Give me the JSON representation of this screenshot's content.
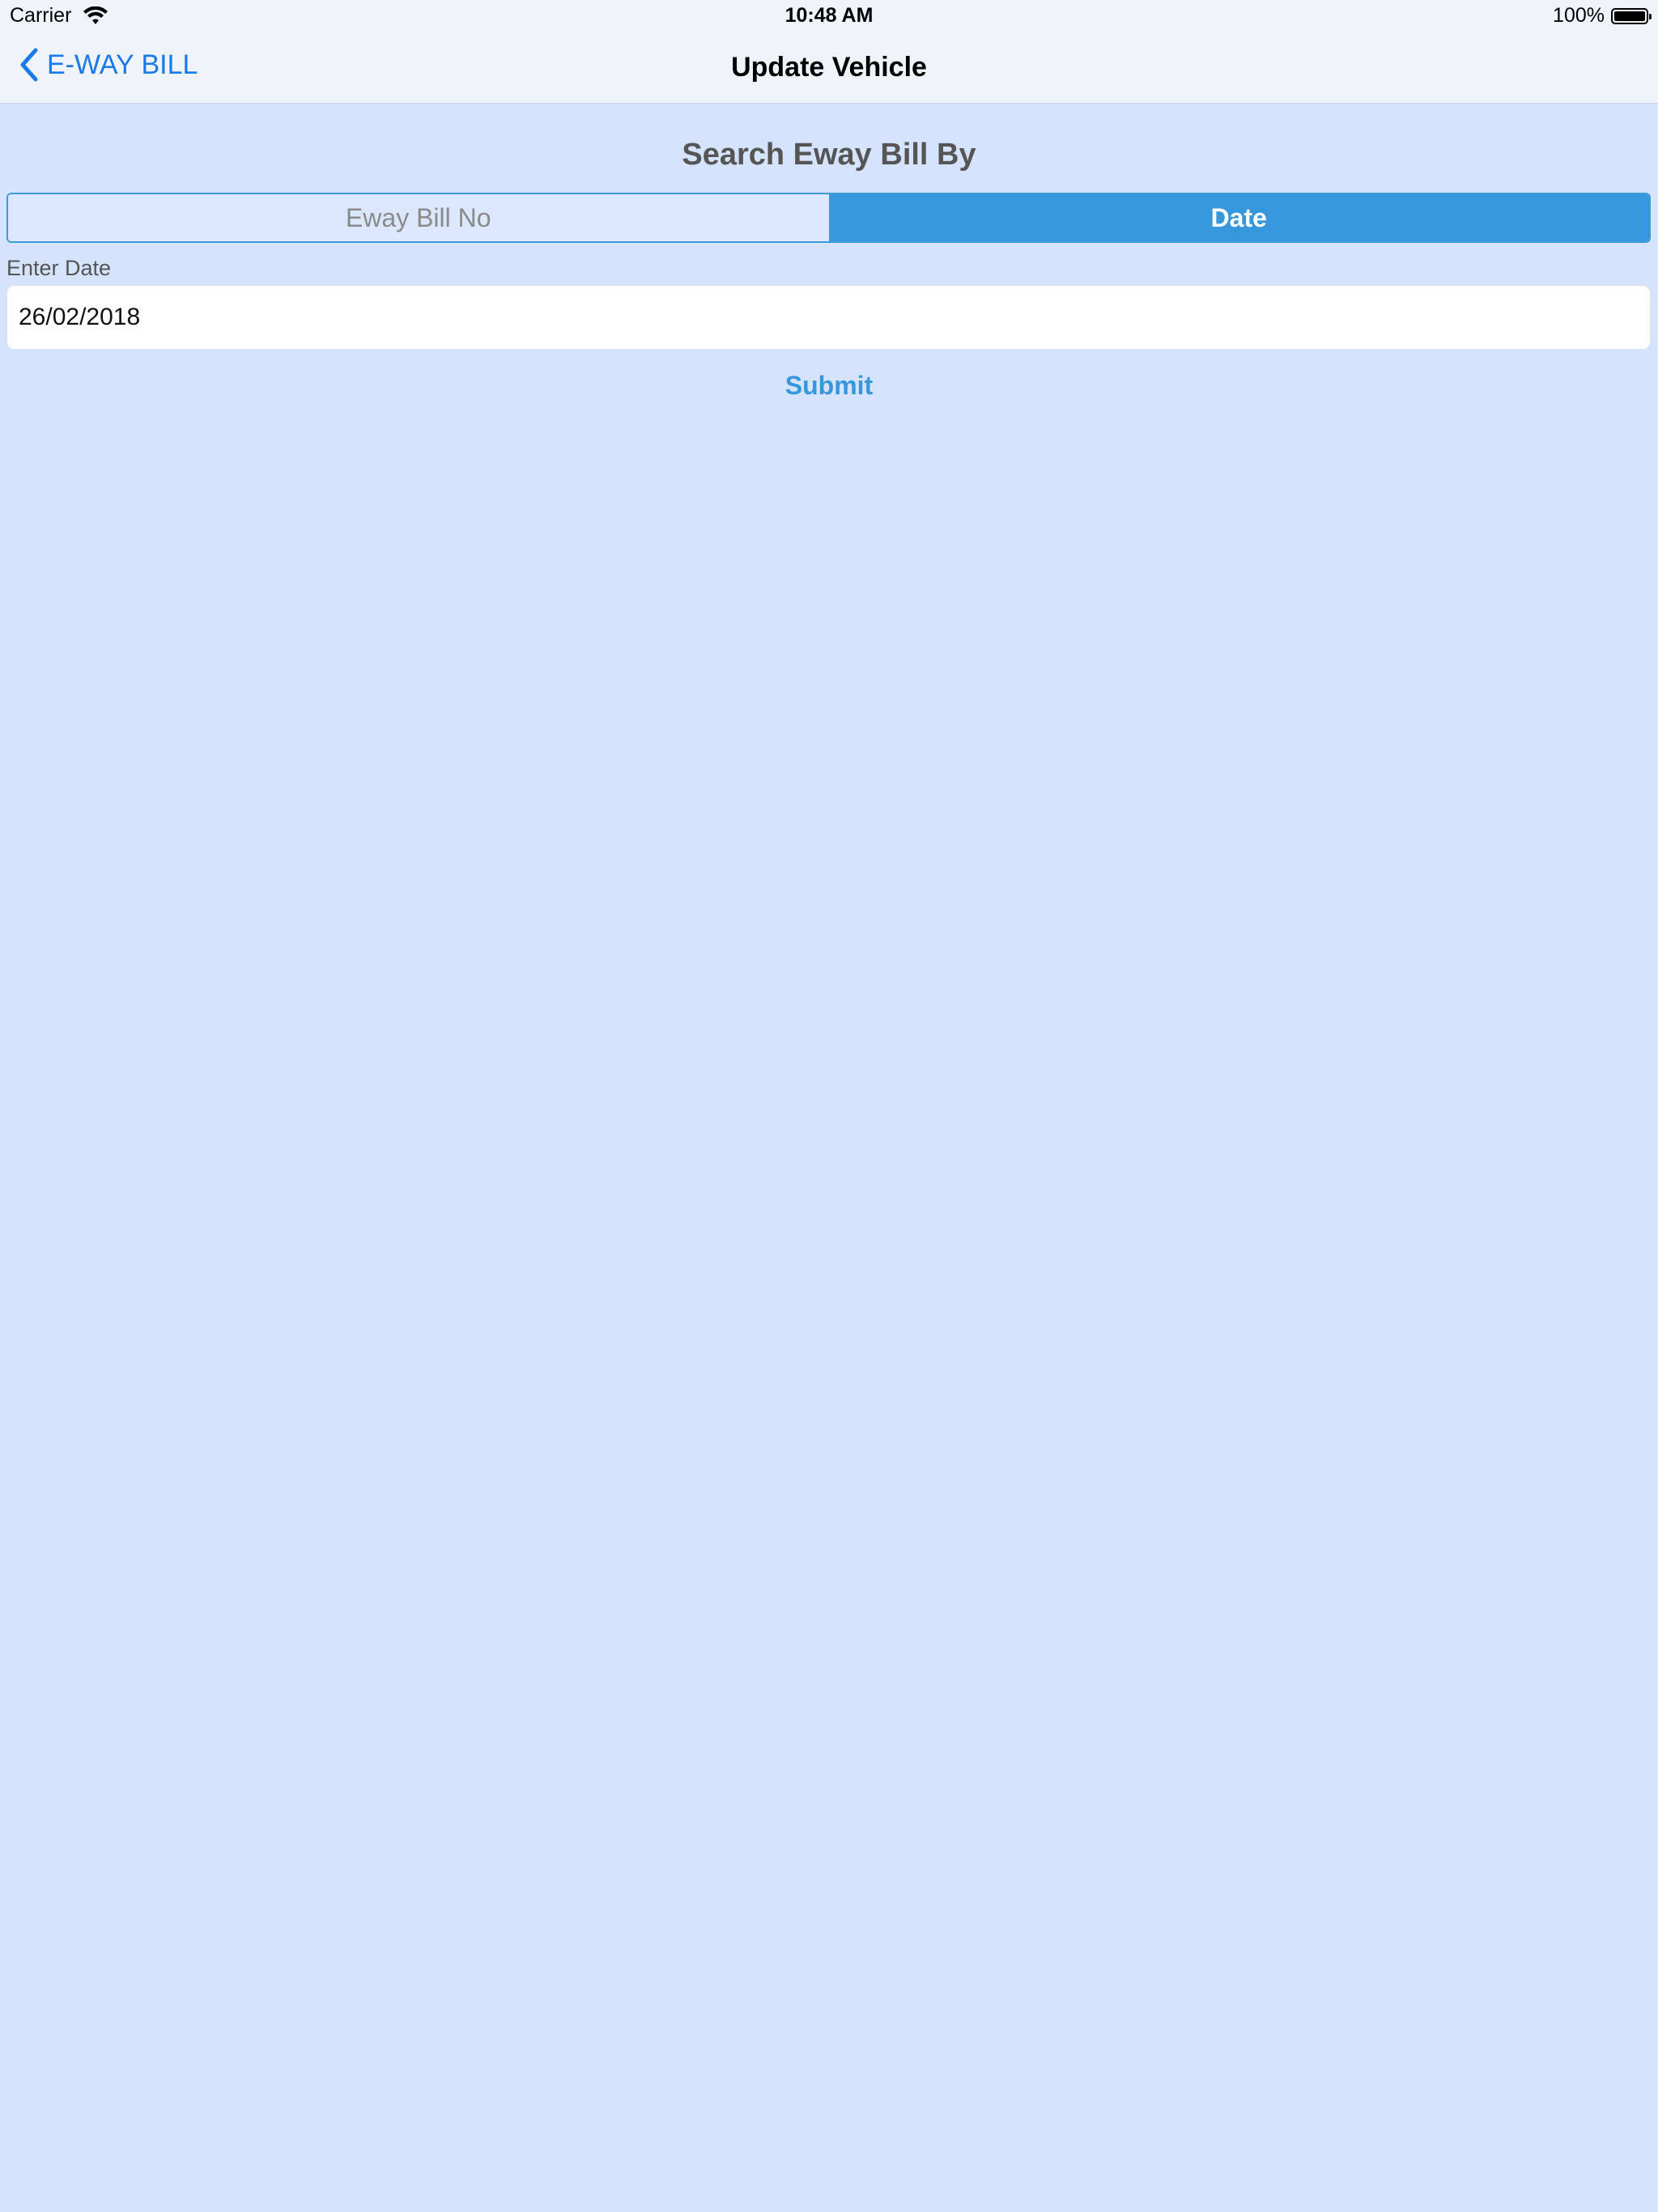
{
  "status_bar": {
    "carrier": "Carrier",
    "time": "10:48 AM",
    "battery_percent": "100%",
    "wifi_icon": "wifi-icon",
    "battery_icon": "battery-icon"
  },
  "nav": {
    "back_label": "E-WAY BILL",
    "back_icon": "chevron-left-icon",
    "title": "Update Vehicle"
  },
  "search": {
    "title": "Search Eway Bill By",
    "segments": [
      {
        "label": "Eway Bill No",
        "selected": false
      },
      {
        "label": "Date",
        "selected": true
      }
    ]
  },
  "form": {
    "date_label": "Enter Date",
    "date_value": "26/02/2018",
    "submit_label": "Submit"
  },
  "colors": {
    "accent": "#3797dc",
    "link": "#1a7ae8",
    "background": "#d5e3fd"
  }
}
